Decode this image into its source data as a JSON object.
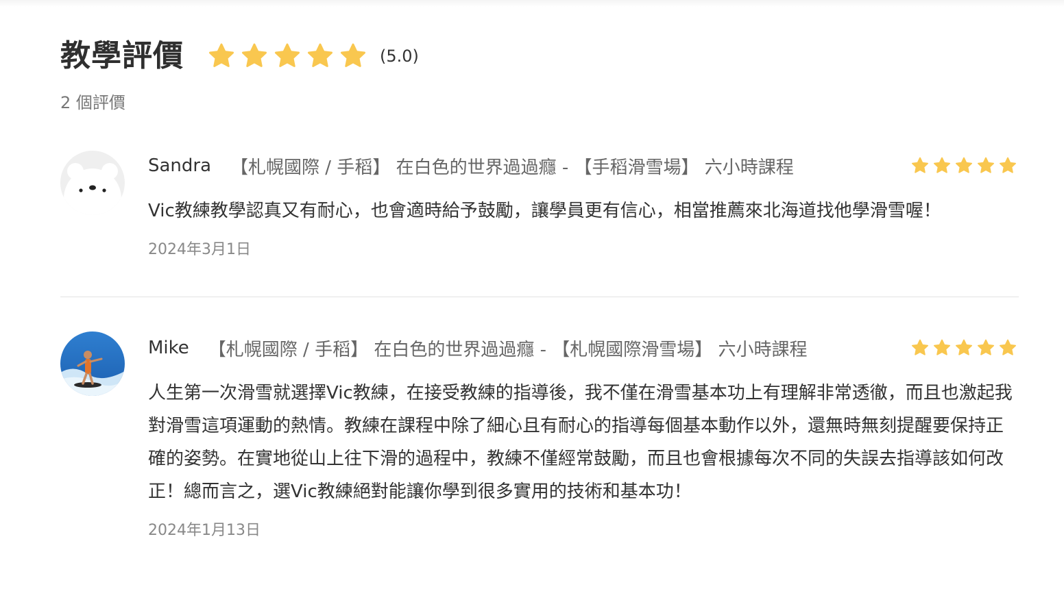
{
  "header": {
    "title": "教學評價",
    "rating_text": "(5.0)",
    "rating_value": 5,
    "star_icon": "star-icon",
    "star_color": "#F9C74F"
  },
  "summary": {
    "count_text": "2 個評價"
  },
  "reviews": [
    {
      "name": "Sandra",
      "course": "【札幌國際 / 手稻】 在白色的世界過過癮 - 【手稻滑雪場】 六小時課程",
      "text": "Vic教練教學認真又有耐心，也會適時給予鼓勵，讓學員更有信心，相當推薦來北海道找他學滑雪喔！",
      "date": "2024年3月1日",
      "rating": 5,
      "avatar": "default-bear-avatar"
    },
    {
      "name": "Mike",
      "course": "【札幌國際 / 手稻】 在白色的世界過過癮 - 【札幌國際滑雪場】 六小時課程",
      "text": "人生第一次滑雪就選擇Vic教練，在接受教練的指導後，我不僅在滑雪基本功上有理解非常透徹，而且也激起我對滑雪這項運動的熱情。教練在課程中除了細心且有耐心的指導每個基本動作以外，還無時無刻提醒要保持正確的姿勢。在實地從山上往下滑的過程中，教練不僅經常鼓勵，而且也會根據每次不同的失誤去指導該如何改正！總而言之，選Vic教練絕對能讓你學到很多實用的技術和基本功！",
      "date": "2024年1月13日",
      "rating": 5,
      "avatar": "surfer-photo-avatar"
    }
  ]
}
